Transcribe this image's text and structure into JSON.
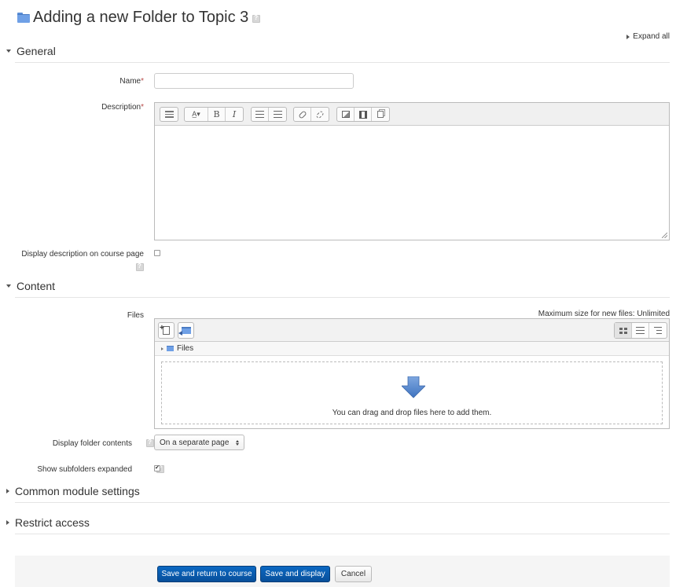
{
  "page": {
    "title": "Adding a new Folder to Topic 3",
    "expand_all": "Expand all"
  },
  "sections": {
    "general": "General",
    "content": "Content",
    "common_module_settings": "Common module settings",
    "restrict_access": "Restrict access"
  },
  "general": {
    "name_label": "Name",
    "name_value": "",
    "description_label": "Description",
    "required_marker": "*",
    "display_description_label": "Display description on course page",
    "display_description_checked": false
  },
  "editor": {
    "toolbar_icons": [
      "collapse-icon",
      "font-style-icon",
      "bold-icon",
      "italic-icon",
      "unordered-list-icon",
      "ordered-list-icon",
      "link-icon",
      "unlink-icon",
      "image-icon",
      "media-icon",
      "manage-files-icon"
    ],
    "bold_glyph": "B",
    "italic_glyph": "I",
    "content": ""
  },
  "content": {
    "files_label": "Files",
    "max_size_text": "Maximum size for new files: Unlimited",
    "path_root": "Files",
    "drop_text": "You can drag and drop files here to add them.",
    "display_folder_label": "Display folder contents",
    "display_folder_value": "On a separate page",
    "show_subfolders_label": "Show subfolders expanded",
    "show_subfolders_checked": true
  },
  "buttons": {
    "save_return": "Save and return to course",
    "save_display": "Save and display",
    "cancel": "Cancel"
  },
  "colors": {
    "primary_button": "#0b68c2",
    "required": "#b94a48",
    "folder": "#6fa0e6"
  }
}
